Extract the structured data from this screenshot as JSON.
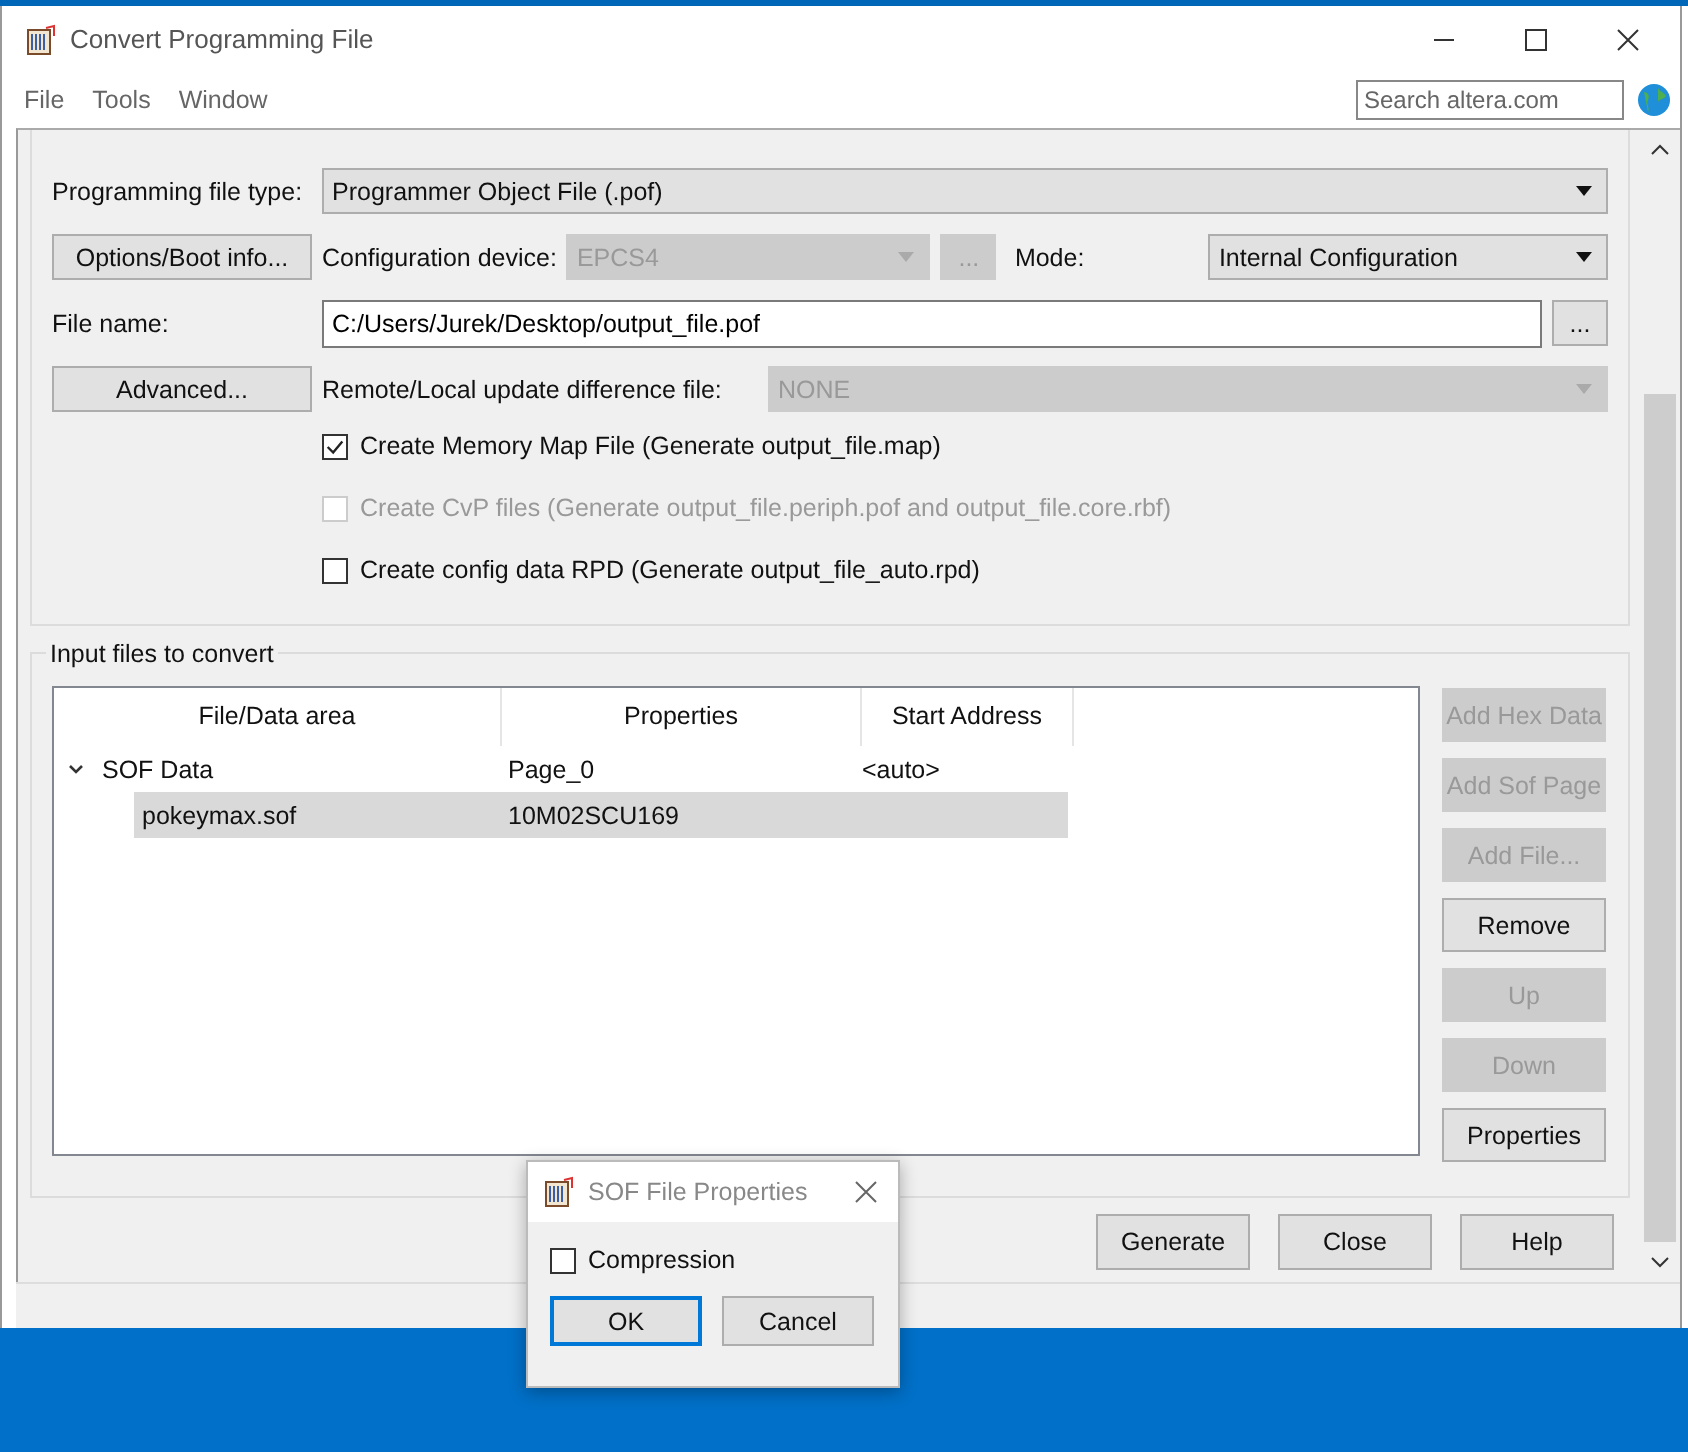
{
  "window": {
    "title": "Convert Programming File"
  },
  "menu": [
    "File",
    "Tools",
    "Window"
  ],
  "search": {
    "placeholder": "Search altera.com"
  },
  "output_group": {
    "file_type": {
      "label": "Programming file type:",
      "value": "Programmer Object File (.pof)"
    },
    "options_button": "Options/Boot info...",
    "config_device": {
      "label": "Configuration device:",
      "value": "EPCS4",
      "disabled": true,
      "browse": "...",
      "browse_disabled": true
    },
    "mode": {
      "label": "Mode:",
      "value": "Internal Configuration"
    },
    "file_name": {
      "label": "File name:",
      "value": "C:/Users/Jurek/Desktop/output_file.pof",
      "browse": "..."
    },
    "advanced_button": "Advanced...",
    "remote": {
      "label": "Remote/Local update difference file:",
      "value": "NONE",
      "disabled": true
    },
    "checkboxes": [
      {
        "label": "Create Memory Map File (Generate output_file.map)",
        "checked": true,
        "disabled": false
      },
      {
        "label": "Create CvP files (Generate output_file.periph.pof and output_file.core.rbf)",
        "checked": false,
        "disabled": true
      },
      {
        "label": "Create config data RPD (Generate output_file_auto.rpd)",
        "checked": false,
        "disabled": false
      }
    ]
  },
  "input_group": {
    "title": "Input files to convert",
    "columns": [
      "File/Data area",
      "Properties",
      "Start Address"
    ],
    "rows": [
      {
        "file_area": "SOF Data",
        "properties": "Page_0",
        "start_address": "<auto>",
        "expanded": true,
        "selected": false,
        "children": [
          {
            "file_area": "pokeymax.sof",
            "properties": "10M02SCU169",
            "selected": true
          }
        ]
      }
    ],
    "buttons": [
      {
        "label": "Add Hex Data",
        "disabled": true
      },
      {
        "label": "Add Sof Page",
        "disabled": true
      },
      {
        "label": "Add File...",
        "disabled": true
      },
      {
        "label": "Remove",
        "disabled": false
      },
      {
        "label": "Up",
        "disabled": true
      },
      {
        "label": "Down",
        "disabled": true
      },
      {
        "label": "Properties",
        "disabled": false
      }
    ]
  },
  "footer_buttons": [
    "Generate",
    "Close",
    "Help"
  ],
  "dialog": {
    "title": "SOF File Properties",
    "checkbox": {
      "label": "Compression",
      "checked": false
    },
    "buttons": [
      {
        "label": "OK",
        "default": true
      },
      {
        "label": "Cancel",
        "default": false
      }
    ]
  }
}
